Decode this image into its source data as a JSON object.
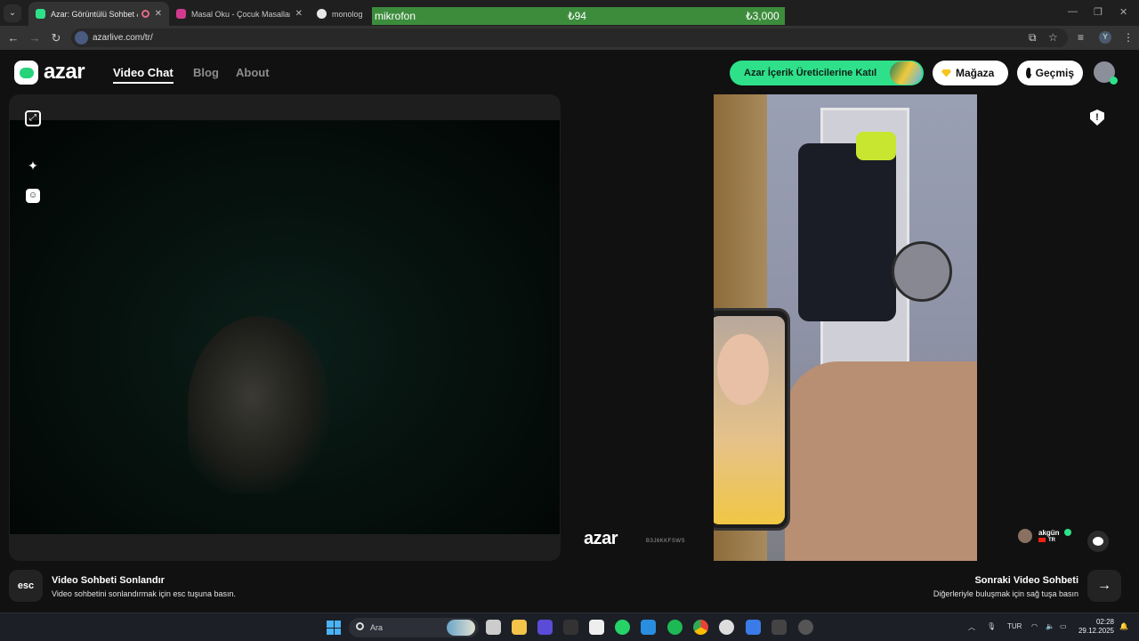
{
  "browser": {
    "tabs": [
      {
        "title": "Azar: Görüntülü Sohbet & Vi",
        "active": true,
        "favicon_color": "#2fe08a"
      },
      {
        "title": "Masal Oku - Çocuk Masalları - M",
        "active": false,
        "favicon_color": "#d23a8e"
      },
      {
        "title": "monolog ne de",
        "active": false,
        "favicon_color": "#e8e8e8"
      }
    ],
    "url": "azarlive.com/tr/"
  },
  "overlay": {
    "label": "mikrofon",
    "value_left": "₺94",
    "value_right": "₺3,000"
  },
  "site": {
    "logo_text": "azar",
    "nav": [
      "Video Chat",
      "Blog",
      "About"
    ],
    "active_nav": "Video Chat",
    "creators_button": "Azar İçerik Üreticilerine Katıl",
    "store_button": "Mağaza",
    "history_button": "Geçmiş",
    "brand_color": "#2fe08a"
  },
  "right_video": {
    "watermark_logo": "azar",
    "watermark_id": "B3J6KKFSWS",
    "peer_name": "akgün",
    "peer_country": "TR"
  },
  "hints": {
    "esc_key": "esc",
    "end_title": "Video Sohbeti Sonlandır",
    "end_desc": "Video sohbetini sonlandırmak için esc tuşuna basın.",
    "next_title": "Sonraki Video Sohbeti",
    "next_desc": "Diğerleriyle buluşmak için sağ tuşa basın"
  },
  "taskbar": {
    "search_placeholder": "Ara",
    "language": "TUR",
    "time": "02:28",
    "date": "29.12.2025"
  }
}
